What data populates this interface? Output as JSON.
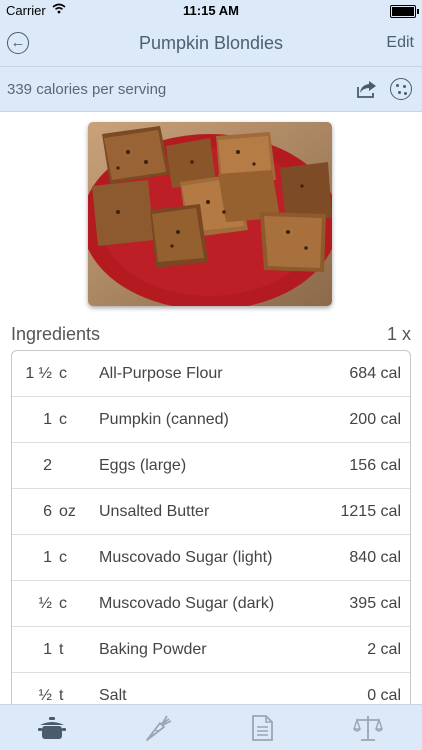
{
  "status": {
    "carrier": "Carrier",
    "time": "11:15 AM"
  },
  "nav": {
    "title": "Pumpkin Blondies",
    "edit_label": "Edit"
  },
  "info": {
    "calories_text": "339 calories per serving"
  },
  "ingredients": {
    "heading": "Ingredients",
    "multiplier": "1 x",
    "rows": [
      {
        "qty": "1 ½",
        "unit": "c",
        "name": "All-Purpose Flour",
        "cal": "684 cal"
      },
      {
        "qty": "1",
        "unit": "c",
        "name": "Pumpkin (canned)",
        "cal": "200 cal"
      },
      {
        "qty": "2",
        "unit": "",
        "name": "Eggs (large)",
        "cal": "156 cal"
      },
      {
        "qty": "6",
        "unit": "oz",
        "name": "Unsalted Butter",
        "cal": "1215 cal"
      },
      {
        "qty": "1",
        "unit": "c",
        "name": "Muscovado Sugar (light)",
        "cal": "840 cal"
      },
      {
        "qty": "½",
        "unit": "c",
        "name": "Muscovado Sugar (dark)",
        "cal": "395 cal"
      },
      {
        "qty": "1",
        "unit": "t",
        "name": "Baking Powder",
        "cal": "2 cal"
      },
      {
        "qty": "½",
        "unit": "t",
        "name": "Salt",
        "cal": "0 cal"
      }
    ]
  },
  "tabs": [
    {
      "icon": "pot-icon",
      "active": true
    },
    {
      "icon": "carrot-icon",
      "active": false
    },
    {
      "icon": "document-icon",
      "active": false
    },
    {
      "icon": "scale-icon",
      "active": false
    }
  ],
  "colors": {
    "bar": "#dce9f9",
    "icon": "#4a5b6e",
    "inactive_icon": "#9aa6b3"
  }
}
